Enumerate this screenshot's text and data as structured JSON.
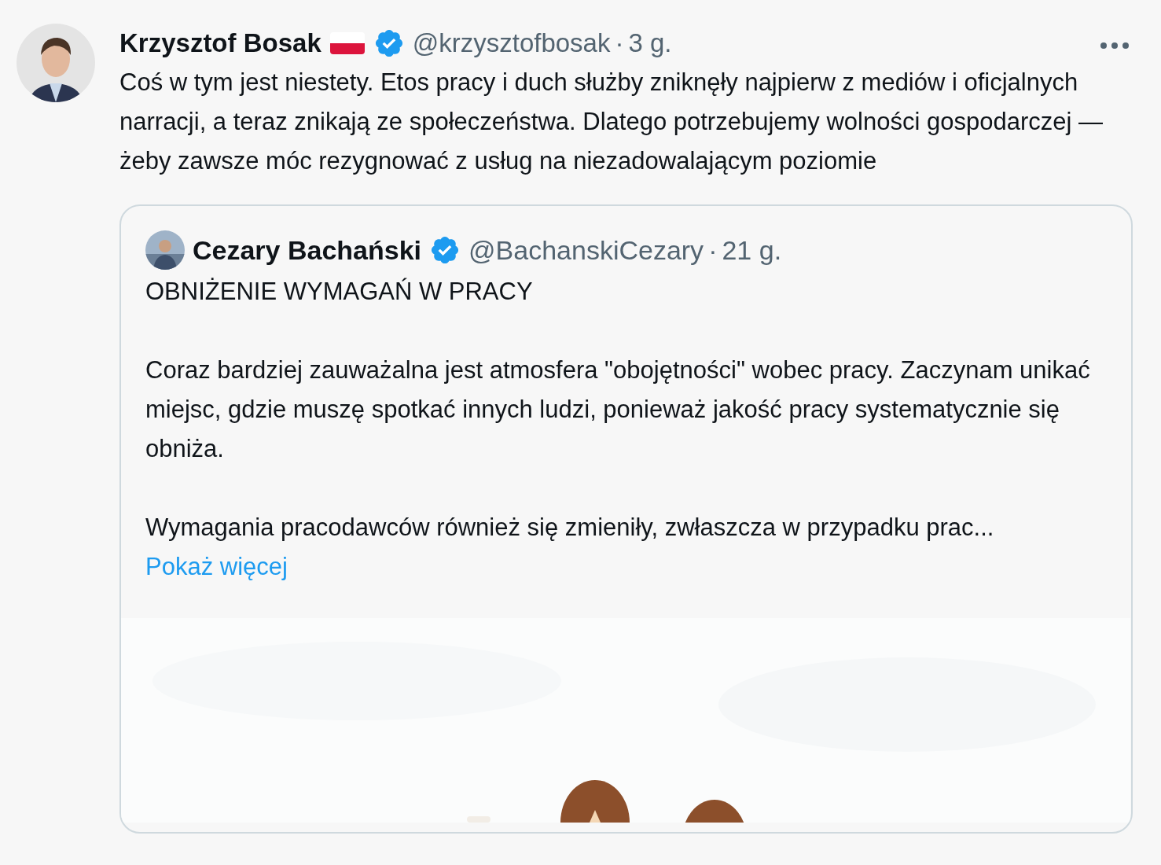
{
  "post": {
    "author": "Krzysztof Bosak",
    "handle": "@krzysztofbosak",
    "separator": "·",
    "time": "3 g.",
    "verified": true,
    "text": "Coś w tym jest niestety. Etos pracy i duch służby zniknęły najpierw z mediów i oficjalnych narracji, a teraz znikają ze społeczeństwa. Dlatego potrzebujemy wolności gospodarczej — żeby zawsze móc rezygnować z usług na niezadowalającym poziomie"
  },
  "quote": {
    "author": "Cezary Bachański",
    "handle": "@BachanskiCezary",
    "separator": "·",
    "time": "21 g.",
    "verified": true,
    "paragraphs": [
      "OBNIŻENIE WYMAGAŃ W PRACY",
      "Coraz bardziej zauważalna jest atmosfera \"obojętności\" wobec pracy. Zaczynam unikać miejsc, gdzie muszę spotkać innych ludzi, ponieważ jakość pracy systematycznie się obniża.",
      "Wymagania pracodawców również się zmieniły, zwłaszcza w przypadku prac..."
    ],
    "more_link": "Pokaż więcej"
  }
}
